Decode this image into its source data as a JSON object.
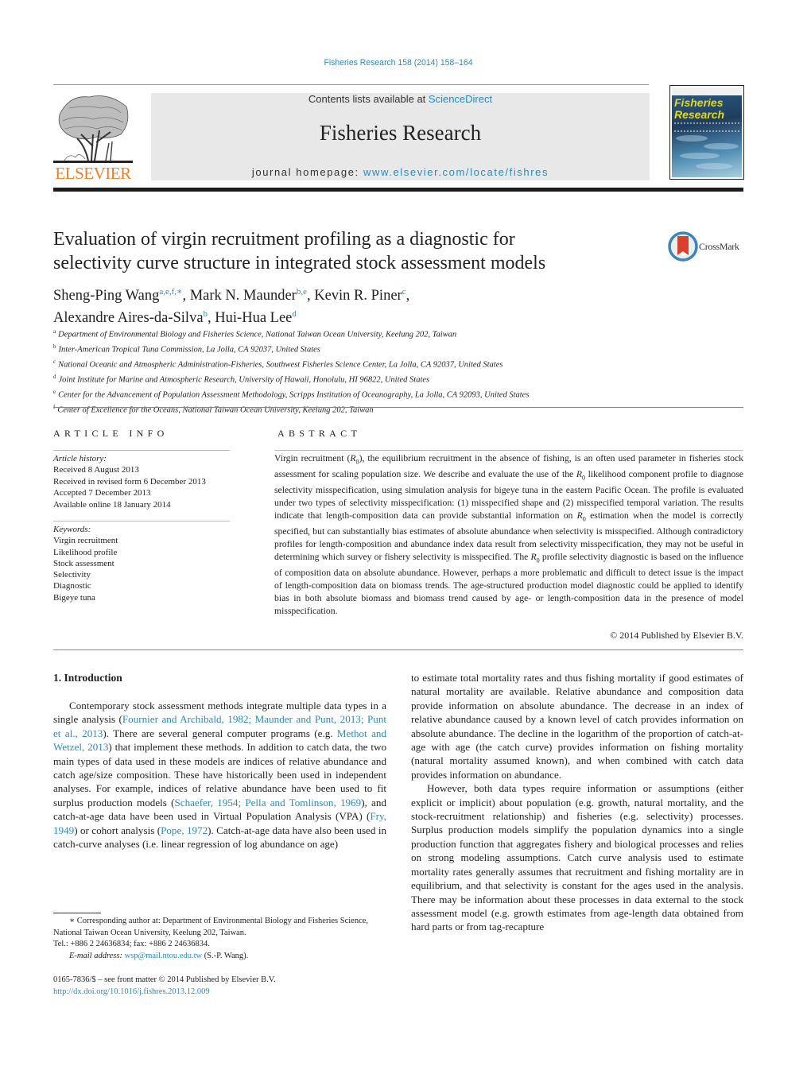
{
  "header": {
    "journal_reference": "Fisheries Research 158 (2014) 158–164",
    "contents_prefix": "Contents lists available at ",
    "contents_link": "ScienceDirect",
    "journal_name": "Fisheries Research",
    "homepage_prefix": "journal homepage: ",
    "homepage_link": "www.elsevier.com/locate/fishres",
    "publisher_logo": "ELSEVIER",
    "cover_title_line1": "Fisheries",
    "cover_title_line2": "Research",
    "link_color": "#2a8ab8",
    "publisher_color": "#f07e26"
  },
  "article": {
    "title_line1": "Evaluation of virgin recruitment profiling as a diagnostic for",
    "title_line2": "selectivity curve structure in integrated stock assessment models",
    "crossmark_label": "CrossMark",
    "authors": [
      {
        "name": "Sheng-Ping Wang",
        "sup": "a,e,f,∗",
        "sep": ", "
      },
      {
        "name": "Mark N. Maunder",
        "sup": "b,e",
        "sep": ", "
      },
      {
        "name": "Kevin R. Piner",
        "sup": "c",
        "sep": ","
      },
      {
        "name": "Alexandre Aires-da-Silva",
        "sup": "b",
        "sep": ", "
      },
      {
        "name": "Hui-Hua Lee",
        "sup": "d",
        "sep": ""
      }
    ],
    "affiliations": [
      {
        "key": "a",
        "text": "Department of Environmental Biology and Fisheries Science, National Taiwan Ocean University, Keelung 202, Taiwan"
      },
      {
        "key": "b",
        "text": "Inter-American Tropical Tuna Commission, La Jolla, CA 92037, United States"
      },
      {
        "key": "c",
        "text": "National Oceanic and Atmospheric Administration-Fisheries, Southwest Fisheries Science Center, La Jolla, CA 92037, United States"
      },
      {
        "key": "d",
        "text": "Joint Institute for Marine and Atmospheric Research, University of Hawaii, Honolulu, HI 96822, United States"
      },
      {
        "key": "e",
        "text": "Center for the Advancement of Population Assessment Methodology, Scripps Institution of Oceanography, La Jolla, CA 92093, United States"
      },
      {
        "key": "f",
        "text": "Center of Excellence for the Oceans, National Taiwan Ocean University, Keelung 202, Taiwan"
      }
    ]
  },
  "article_info": {
    "heading": "ARTICLE INFO",
    "history_label": "Article history:",
    "history": [
      "Received 8 August 2013",
      "Received in revised form 6 December 2013",
      "Accepted 7 December 2013",
      "Available online 18 January 2014"
    ],
    "keywords_label": "Keywords:",
    "keywords": [
      "Virgin recruitment",
      "Likelihood profile",
      "Stock assessment",
      "Selectivity",
      "Diagnostic",
      "Bigeye tuna"
    ]
  },
  "abstract": {
    "heading": "ABSTRACT",
    "parts": [
      {
        "t": "Virgin recruitment ("
      },
      {
        "r0": true
      },
      {
        "t": "), the equilibrium recruitment in the absence of fishing, is an often used parameter in fisheries stock assessment for scaling population size. We describe and evaluate the use of the "
      },
      {
        "r0": true
      },
      {
        "t": " likelihood component profile to diagnose selectivity misspecification, using simulation analysis for bigeye tuna in the eastern Pacific Ocean. The profile is evaluated under two types of selectivity misspecification: (1) misspecified shape and (2) misspecified temporal variation. The results indicate that length-composition data can provide substantial information on "
      },
      {
        "r0": true
      },
      {
        "t": " estimation when the model is correctly specified, but can substantially bias estimates of absolute abundance when selectivity is misspecified. Although contradictory profiles for length-composition and abundance index data result from selectivity misspecification, they may not be useful in determining which survey or fishery selectivity is misspecified. The "
      },
      {
        "r0": true
      },
      {
        "t": " profile selectivity diagnostic is based on the influence of composition data on absolute abundance. However, perhaps a more problematic and difficult to detect issue is the impact of length-composition data on biomass trends. The age-structured production model diagnostic could be applied to identify bias in both absolute biomass and biomass trend caused by age- or length-composition data in the presence of model misspecification."
      }
    ],
    "copyright": "© 2014 Published by Elsevier B.V."
  },
  "introduction": {
    "heading": "1.  Introduction",
    "left_paragraph": [
      {
        "t": "Contemporary stock assessment methods integrate multiple data types in a single analysis ("
      },
      {
        "link": "Fournier and Archibald, 1982; Maunder and Punt, 2013; Punt et al., 2013"
      },
      {
        "t": "). There are several general computer programs (e.g. "
      },
      {
        "link": "Methot and Wetzel, 2013"
      },
      {
        "t": ") that implement these methods. In addition to catch data, the two main types of data used in these models are indices of relative abundance and catch age/size composition. These have historically been used in independent analyses. For example, indices of relative abundance have been used to fit surplus production models ("
      },
      {
        "link": "Schaefer, 1954; Pella and Tomlinson, 1969"
      },
      {
        "t": "), and catch-at-age data have been used in Virtual Population Analysis (VPA) ("
      },
      {
        "link": "Fry, 1949"
      },
      {
        "t": ") or cohort analysis ("
      },
      {
        "link": "Pope, 1972"
      },
      {
        "t": "). Catch-at-age data have also been used in catch-curve analyses (i.e. linear regression of log abundance on age)"
      }
    ],
    "right_continuation": "to estimate total mortality rates and thus fishing mortality if good estimates of natural mortality are available. Relative abundance and composition data provide information on absolute abundance. The decrease in an index of relative abundance caused by a known level of catch provides information on absolute abundance. The decline in the logarithm of the proportion of catch-at-age with age (the catch curve) provides information on fishing mortality (natural mortality assumed known), and when combined with catch data provides information on abundance.",
    "right_paragraph2": "However, both data types require information or assumptions (either explicit or implicit) about population (e.g. growth, natural mortality, and the stock-recruitment relationship) and fisheries (e.g. selectivity) processes. Surplus production models simplify the population dynamics into a single production function that aggregates fishery and biological processes and relies on strong modeling assumptions. Catch curve analysis used to estimate mortality rates generally assumes that recruitment and fishing mortality are in equilibrium, and that selectivity is constant for the ages used in the analysis. There may be information about these processes in data external to the stock assessment model (e.g. growth estimates from age-length data obtained from hard parts or from tag-recapture"
  },
  "footnote": {
    "marker": "∗",
    "corresponding": " Corresponding author at: Department of Environmental Biology and Fisheries Science, National Taiwan Ocean University, Keelung 202, Taiwan.",
    "tel_fax": "Tel.: +886 2 24636834; fax: +886 2 24636834.",
    "email_label": "E-mail address: ",
    "email": "wsp@mail.ntou.edu.tw",
    "email_suffix": " (S.-P. Wang)."
  },
  "front_matter": {
    "issn_line": "0165-7836/$ – see front matter © 2014 Published by Elsevier B.V.",
    "doi_link": "http://dx.doi.org/10.1016/j.fishres.2013.12.009"
  }
}
